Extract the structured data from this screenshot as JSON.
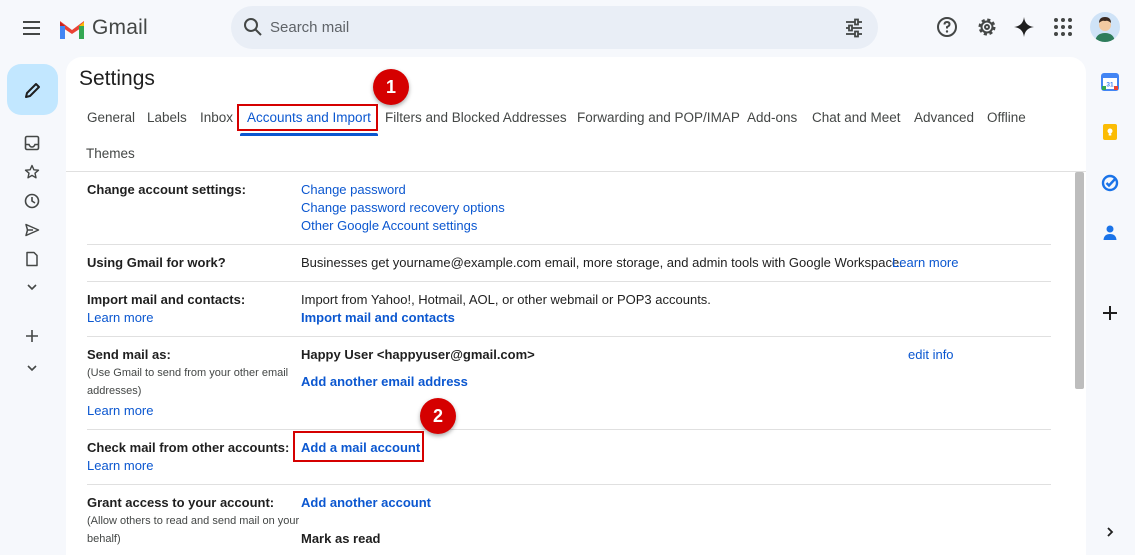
{
  "header": {
    "brand": "Gmail",
    "search_placeholder": "Search mail"
  },
  "settings": {
    "title": "Settings",
    "tabs": [
      {
        "label": "General"
      },
      {
        "label": "Labels"
      },
      {
        "label": "Inbox"
      },
      {
        "label": "Accounts and Import",
        "active": true
      },
      {
        "label": "Filters and Blocked Addresses"
      },
      {
        "label": "Forwarding and POP/IMAP"
      },
      {
        "label": "Add-ons"
      },
      {
        "label": "Chat and Meet"
      },
      {
        "label": "Advanced"
      },
      {
        "label": "Offline"
      },
      {
        "label": "Themes"
      }
    ],
    "sections": {
      "change_account": {
        "label": "Change account settings:",
        "links": [
          "Change password",
          "Change password recovery options",
          "Other Google Account settings"
        ]
      },
      "gmail_work": {
        "label": "Using Gmail for work?",
        "text": "Businesses get yourname@example.com email, more storage, and admin tools with Google Workspace.",
        "link": "Learn more"
      },
      "import": {
        "label": "Import mail and contacts:",
        "learn_more": "Learn more",
        "text": "Import from Yahoo!, Hotmail, AOL, or other webmail or POP3 accounts.",
        "action": "Import mail and contacts"
      },
      "send_as": {
        "label": "Send mail as:",
        "sub1": "(Use Gmail to send from your other email",
        "sub2": "addresses)",
        "learn_more": "Learn more",
        "identity": "Happy User <happyuser@gmail.com>",
        "edit": "edit info",
        "add": "Add another email address"
      },
      "check_mail": {
        "label": "Check mail from other accounts:",
        "learn_more": "Learn more",
        "add": "Add a mail account"
      },
      "grant_access": {
        "label": "Grant access to your account:",
        "sub1": "(Allow others to read and send mail on your",
        "sub2": "behalf)",
        "add": "Add another account",
        "mark_read": "Mark as read"
      }
    }
  },
  "annotations": {
    "marker1": "1",
    "marker2": "2",
    "highlight_color": "#d50000"
  },
  "icons": [
    "menu-icon",
    "gmail-logo-icon",
    "search-icon",
    "tune-icon",
    "help-icon",
    "settings-gear-icon",
    "gemini-sparkle-icon",
    "apps-grid-icon",
    "pencil-icon",
    "inbox-icon",
    "star-icon",
    "clock-icon",
    "send-icon",
    "draft-icon",
    "chevron-down-icon",
    "plus-icon",
    "calendar-icon",
    "keep-icon",
    "tasks-icon",
    "contacts-icon",
    "chevron-right-icon"
  ]
}
